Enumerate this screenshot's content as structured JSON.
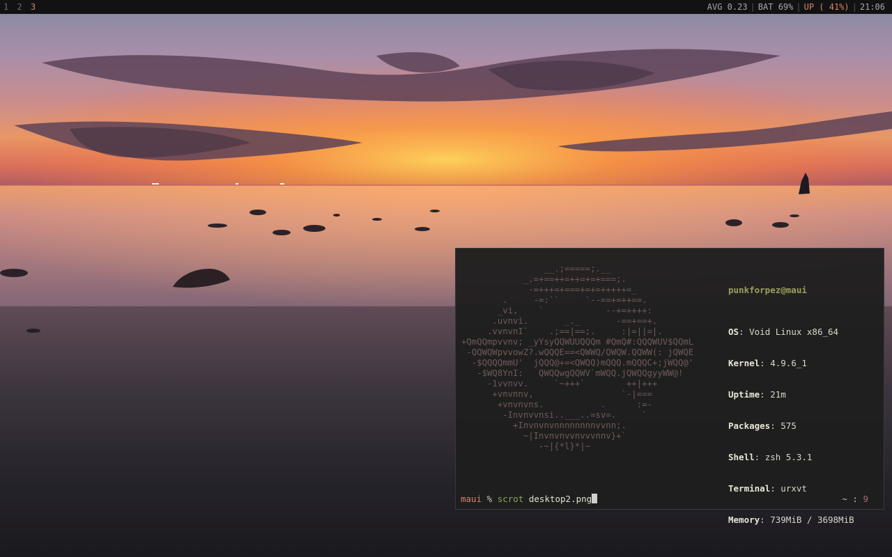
{
  "topbar": {
    "workspaces": [
      {
        "label": "1",
        "active": false
      },
      {
        "label": "2",
        "active": false
      },
      {
        "label": "3",
        "active": true
      }
    ],
    "avg": "AVG 0.23",
    "battery": "BAT 69%",
    "uptime_status": "UP ( 41%)",
    "clock": "21:06",
    "separator": "|"
  },
  "terminal": {
    "ascii_logo": "                __.;=====;.__\n            _.=+==++=++=+=+===;.\n             -=+++=+===+=+=+++++=_\n        .     -=:``     `--==+=++==.\n       _vi,    `            --+=++++:\n      .uvnvi.       _._       -==+==+.\n     .vvnvnI`    .;==|==;.     :|=||=|.\n+QmQQmpvvnv; _yYsyQQWUUQQQm #QmQ#:QQQWUV$QQmL\n -QQWQWpvvowZ?.wQQQE==<QWWQ/QWQW.QQWW(: jQWQE\n  -$QQQQmmU'  jQQQ@+=<QWQQ)mQQQ.mQQQC+;jWQQ@'\n   -$WQ8YnI:   QWQQwgQQWV`mWQQ.jQWQQgyyWW@!\n     -1vvnvv.     `~+++`        ++|+++\n      +vnvnnv,                 `-|===\n       +vnvnvns.           .      :=-\n        -Invnvvnsi..___..=sv=.     `\n          +Invnvnvnnnnnnnnvvnn;.\n            ~|Invnvnvvnvvvnnv}+`\n               -~|{*l}*|~",
    "user_host": "punkforpez@maui",
    "info": [
      {
        "key": "OS",
        "value": "Void Linux x86_64"
      },
      {
        "key": "Kernel",
        "value": "4.9.6_1"
      },
      {
        "key": "Uptime",
        "value": "21m"
      },
      {
        "key": "Packages",
        "value": "575"
      },
      {
        "key": "Shell",
        "value": "zsh 5.3.1"
      },
      {
        "key": "Terminal",
        "value": "urxvt"
      },
      {
        "key": "Memory",
        "value": "739MiB / 3698MiB"
      }
    ],
    "prompt": {
      "host": "maui",
      "symbol": "%",
      "command": "scrot",
      "argument": "desktop2.png",
      "right_dir": "~",
      "right_sep": ":",
      "right_num": "9"
    }
  }
}
